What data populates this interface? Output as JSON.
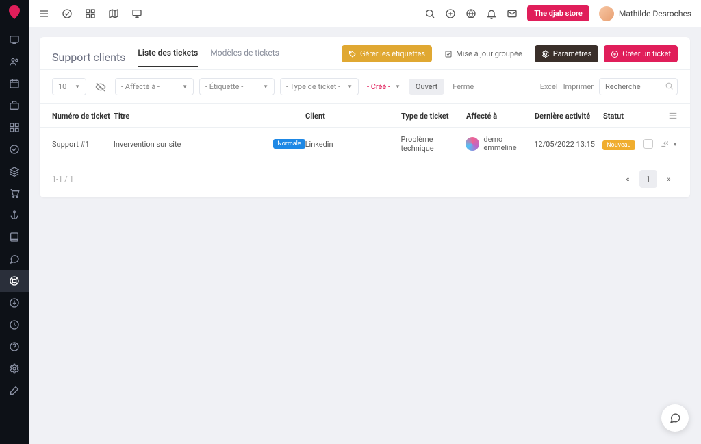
{
  "topbar": {
    "store_button": "The djab store",
    "username": "Mathilde Desroches"
  },
  "page": {
    "title": "Support clients",
    "tabs": [
      {
        "label": "Liste des tickets",
        "active": true
      },
      {
        "label": "Modèles de tickets",
        "active": false
      }
    ],
    "actions": {
      "manage_labels": "Gérer les étiquettes",
      "bulk_update": "Mise à jour groupée",
      "settings": "Paramètres",
      "create_ticket": "Créer un ticket"
    }
  },
  "filters": {
    "page_size": "10",
    "assigned": "- Affecté à -",
    "label": "- Étiquette -",
    "type": "- Type de ticket -",
    "created": "- Créé -",
    "status_open": "Ouvert",
    "status_closed": "Fermé",
    "export_excel": "Excel",
    "export_print": "Imprimer",
    "search_placeholder": "Recherche"
  },
  "table": {
    "headers": {
      "number": "Numéro de ticket",
      "title": "Titre",
      "client": "Client",
      "type": "Type de ticket",
      "assigned": "Affecté à",
      "activity": "Dernière activité",
      "status": "Statut"
    },
    "rows": [
      {
        "number": "Support #1",
        "title": "Invervention sur site",
        "priority": "Normale",
        "client": "Linkedin",
        "type": "Problème technique",
        "assigned": "demo emmeline",
        "activity": "12/05/2022 13:15",
        "status": "Nouveau"
      }
    ],
    "footer_count": "1-1 / 1",
    "current_page": "1"
  }
}
